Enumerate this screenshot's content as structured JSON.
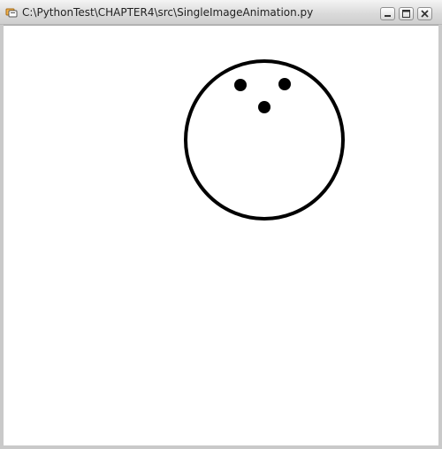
{
  "window": {
    "title": "C:\\PythonTest\\CHAPTER4\\src\\SingleImageAnimation.py",
    "controls": {
      "minimize_icon": "minimize-icon",
      "maximize_icon": "maximize-icon",
      "close_icon": "close-icon"
    }
  },
  "canvas": {
    "background_color": "#ffffff",
    "drawing": {
      "shape": "bowling-ball-outline",
      "outline_color": "#000000",
      "hole_color": "#000000",
      "hole_count": 3
    }
  }
}
